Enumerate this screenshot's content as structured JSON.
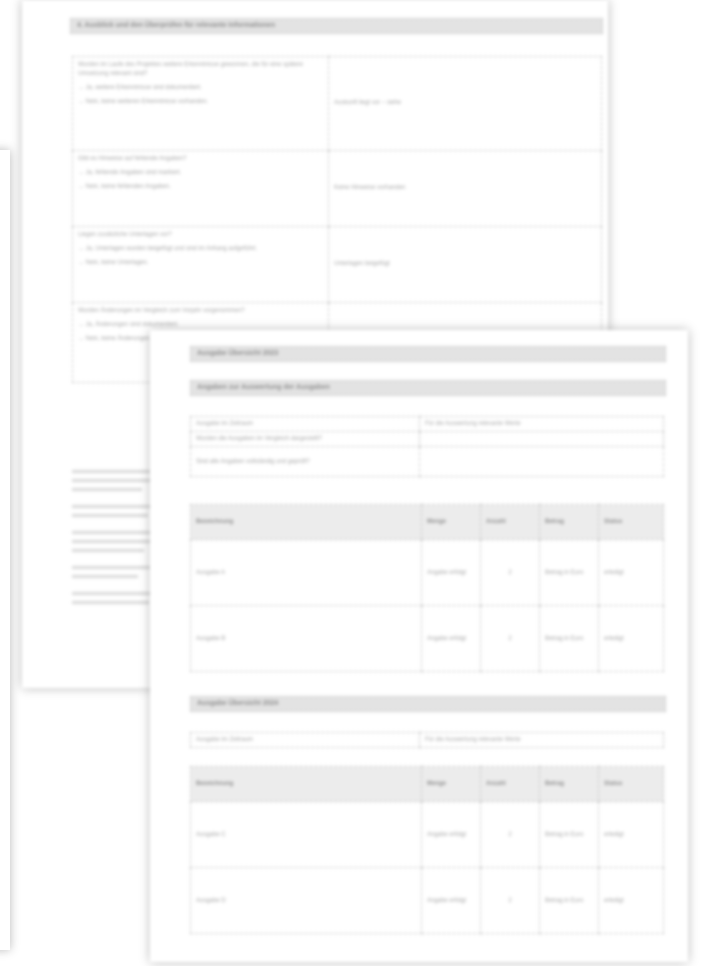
{
  "back_page": {},
  "mid_page": {
    "header": "4. Ausblick und den Überprüfen für relevante Informationen",
    "rows": [
      {
        "question": "Wurden im Laufe des Projektes weitere Erkenntnisse gewonnen, die für eine spätere Umsetzung relevant sind?",
        "options": [
          "→ Ja, weitere Erkenntnisse sind dokumentiert.",
          "→ Nein, keine weiteren Erkenntnisse vorhanden."
        ],
        "answer": "Auskunft liegt vor – siehe"
      },
      {
        "question": "Gibt es Hinweise auf fehlende Angaben?",
        "options": [
          "→ Ja, fehlende Angaben sind markiert.",
          "→ Nein, keine fehlenden Angaben."
        ],
        "answer": "Keine Hinweise vorhanden"
      },
      {
        "question": "Liegen zusätzliche Unterlagen vor?",
        "options": [
          "→ Ja, Unterlagen wurden beigefügt und sind im Anhang aufgeführt.",
          "→ Nein, keine Unterlagen."
        ],
        "answer": "Unterlagen beigefügt"
      },
      {
        "question": "Wurden Änderungen im Vergleich zum Vorjahr vorgenommen?",
        "options": [
          "→ Ja, Änderungen sind dokumentiert.",
          "→ Nein, keine Änderungen."
        ],
        "answer": ""
      }
    ]
  },
  "front_page": {
    "section1": {
      "header": "Ausgabe Übersicht 2023",
      "subheader": "Angaben zur Auswertung der Ausgaben",
      "info_rows": [
        {
          "label": "Ausgabe im Zeitraum",
          "value": "Für die Auswertung relevante Werte"
        },
        {
          "label": "Wurden die Ausgaben im Vergleich dargestellt?",
          "value": ""
        },
        {
          "label": "Sind alle Angaben vollständig und geprüft?",
          "value": ""
        }
      ],
      "columns": [
        "Bezeichnung",
        "Menge",
        "Anzahl",
        "Betrag",
        "Status"
      ],
      "rows": [
        {
          "name": "Ausgabe A",
          "detail": "Angabe erfolgt",
          "count": "2",
          "amount": "Betrag in Euro",
          "status": "erledigt"
        },
        {
          "name": "Ausgabe B",
          "detail": "Angabe erfolgt",
          "count": "2",
          "amount": "Betrag in Euro",
          "status": "erledigt"
        }
      ]
    },
    "section2": {
      "header": "Ausgabe Übersicht 2024",
      "info_rows": [
        {
          "label": "Ausgabe im Zeitraum",
          "value": "Für die Auswertung relevante Werte"
        }
      ],
      "columns": [
        "Bezeichnung",
        "Menge",
        "Anzahl",
        "Betrag",
        "Status"
      ],
      "rows": [
        {
          "name": "Ausgabe C",
          "detail": "Angabe erfolgt",
          "count": "2",
          "amount": "Betrag in Euro",
          "status": "erledigt"
        },
        {
          "name": "Ausgabe D",
          "detail": "Angabe erfolgt",
          "count": "2",
          "amount": "Betrag in Euro",
          "status": "erledigt"
        }
      ]
    }
  }
}
